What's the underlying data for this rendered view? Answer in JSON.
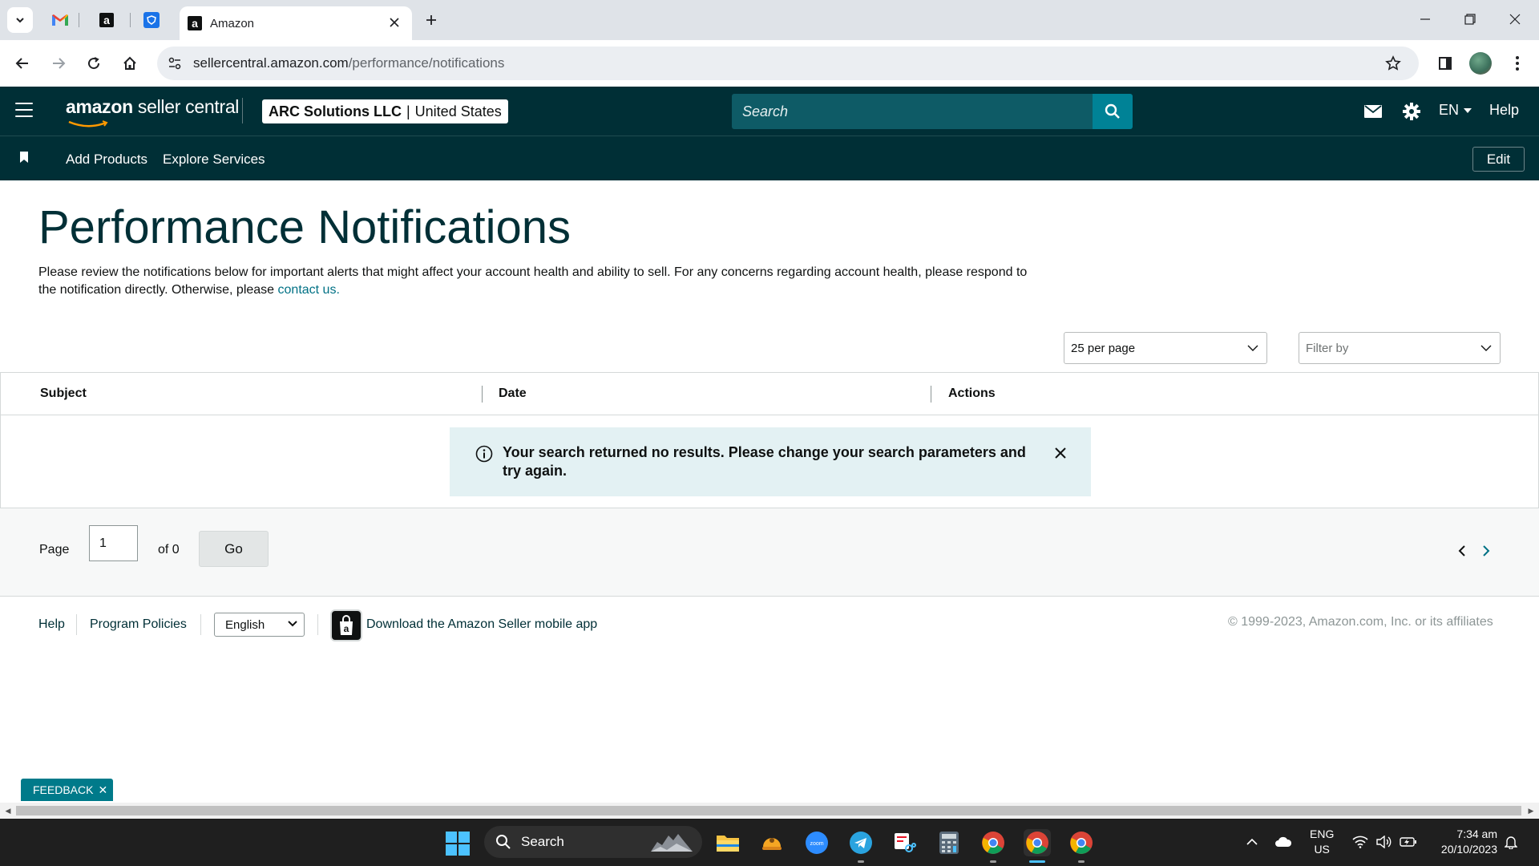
{
  "browser": {
    "tab_title": "Amazon",
    "url_host": "sellercentral.amazon.com",
    "url_path": "/performance/notifications"
  },
  "header": {
    "logo_brand": "amazon",
    "logo_product": " seller central",
    "account_name": "ARC Solutions LLC",
    "account_separator": "|",
    "account_region": "United States",
    "search_placeholder": "Search",
    "language": "EN",
    "help": "Help"
  },
  "subnav": {
    "links": [
      "Add Products",
      "Explore Services"
    ],
    "edit": "Edit"
  },
  "main": {
    "title": "Performance Notifications",
    "description": "Please review the notifications below for important alerts that might affect your account health and ability to sell. For any concerns regarding account health, please respond to the notification directly. Otherwise, please ",
    "contact_link": "contact us.",
    "per_page": "25 per page",
    "filter_placeholder": "Filter by",
    "columns": [
      "Subject",
      "Date",
      "Actions"
    ],
    "alert_message": "Your search returned no results. Please change your search parameters and try again."
  },
  "pager": {
    "page_label": "Page",
    "page_value": "1",
    "of_label": "of 0",
    "go": "Go"
  },
  "footer": {
    "help": "Help",
    "policies": "Program Policies",
    "language": "English",
    "app_text": "Download the Amazon Seller mobile app",
    "copyright": "© 1999-2023, Amazon.com, Inc. or its affiliates"
  },
  "feedback": "FEEDBACK",
  "taskbar": {
    "search": "Search",
    "lang_line1": "ENG",
    "lang_line2": "US",
    "time": "7:34 am",
    "date": "20/10/2023"
  },
  "colors": {
    "header_bg": "#002f36",
    "accent": "#008296",
    "link": "#007185",
    "alert_bg": "#e3f1f3"
  }
}
